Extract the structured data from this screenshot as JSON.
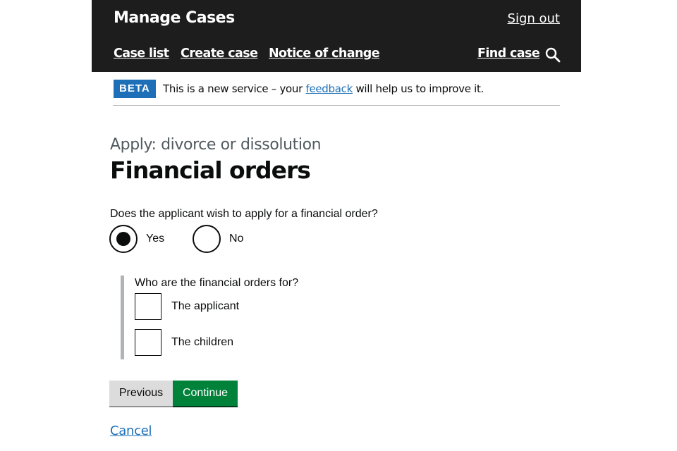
{
  "header": {
    "app_title": "Manage Cases",
    "sign_out": "Sign out",
    "nav": {
      "case_list": "Case list",
      "create_case": "Create case",
      "notice_of_change": "Notice of change",
      "find_case": "Find case"
    },
    "search_icon": "search-icon"
  },
  "beta_banner": {
    "tag": "BETA",
    "text_before": "This is a new service – your",
    "link": "feedback",
    "text_after": "will help us to improve it."
  },
  "page": {
    "caption": "Apply: divorce or dissolution",
    "title": "Financial orders"
  },
  "question": {
    "label": "Does the applicant wish to apply for a financial order?",
    "options": [
      {
        "label": "Yes",
        "selected": true
      },
      {
        "label": "No",
        "selected": false
      }
    ]
  },
  "conditional": {
    "label": "Who are the financial orders for?",
    "options": [
      {
        "label": "The applicant",
        "checked": false
      },
      {
        "label": "The children",
        "checked": false
      }
    ]
  },
  "buttons": {
    "previous": "Previous",
    "continue": "Continue"
  },
  "cancel": "Cancel",
  "colors": {
    "header_bg": "#1d1d1d",
    "beta_tag": "#1d70b8",
    "link": "#1d70b8",
    "continue_button": "#00823b",
    "previous_button": "#dcdcdc",
    "inset_border": "#b1b4b6"
  }
}
